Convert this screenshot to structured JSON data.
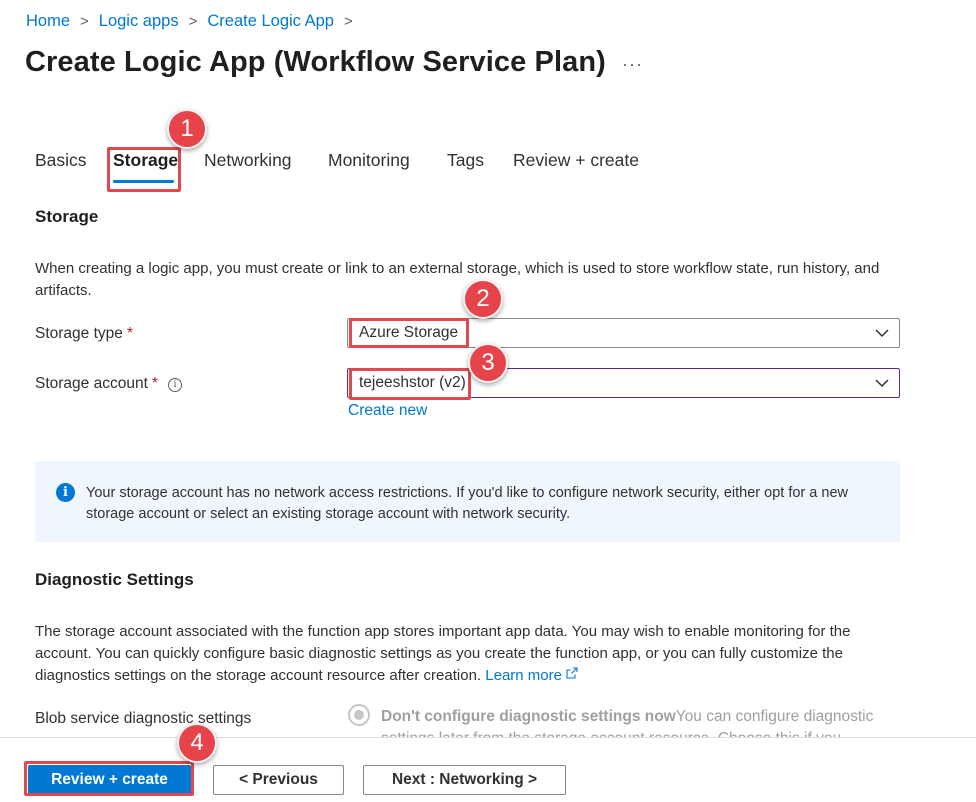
{
  "breadcrumb": {
    "items": [
      "Home",
      "Logic apps",
      "Create Logic App"
    ],
    "separator": ">"
  },
  "page": {
    "title": "Create Logic App (Workflow Service Plan)",
    "more_label": "···"
  },
  "tabs": [
    {
      "label": "Basics"
    },
    {
      "label": "Storage"
    },
    {
      "label": "Networking"
    },
    {
      "label": "Monitoring"
    },
    {
      "label": "Tags"
    },
    {
      "label": "Review + create"
    }
  ],
  "active_tab": "Storage",
  "storage": {
    "heading": "Storage",
    "description": "When creating a logic app, you must create or link to an external storage, which is used to store workflow state, run history, and artifacts.",
    "storage_type": {
      "label": "Storage type",
      "required": "*",
      "value": "Azure Storage"
    },
    "storage_account": {
      "label": "Storage account",
      "required": "*",
      "value": "tejeeshstor (v2)",
      "info_icon": "i"
    },
    "create_new": "Create new"
  },
  "info_box": {
    "icon": "i",
    "text": "Your storage account has no network access restrictions. If you'd like to configure network security, either opt for a new storage account or select an existing storage account with network security."
  },
  "diagnostics": {
    "heading": "Diagnostic Settings",
    "description": "The storage account associated with the function app stores important app data. You may wish to enable monitoring for the account. You can quickly configure basic diagnostic settings as you create the function app, or you can fully customize the diagnostics settings on the storage account resource after creation.",
    "learn_more": "Learn more",
    "blob_label": "Blob service diagnostic settings",
    "option_title": "Don't configure diagnostic settings now",
    "option_text": "You can configure diagnostic settings later from the storage account resource. Choose this if you"
  },
  "footer": {
    "review_create": "Review + create",
    "previous": "< Previous",
    "next": "Next : Networking >"
  },
  "annotations": {
    "badge_1": "1",
    "badge_2": "2",
    "badge_3": "3",
    "badge_4": "4"
  },
  "colors": {
    "accent": "#0078d4",
    "highlight": "#e0484e",
    "badge": "#e6434a",
    "info_bg": "#f0f6fd",
    "focus_border": "#5c2d91"
  }
}
